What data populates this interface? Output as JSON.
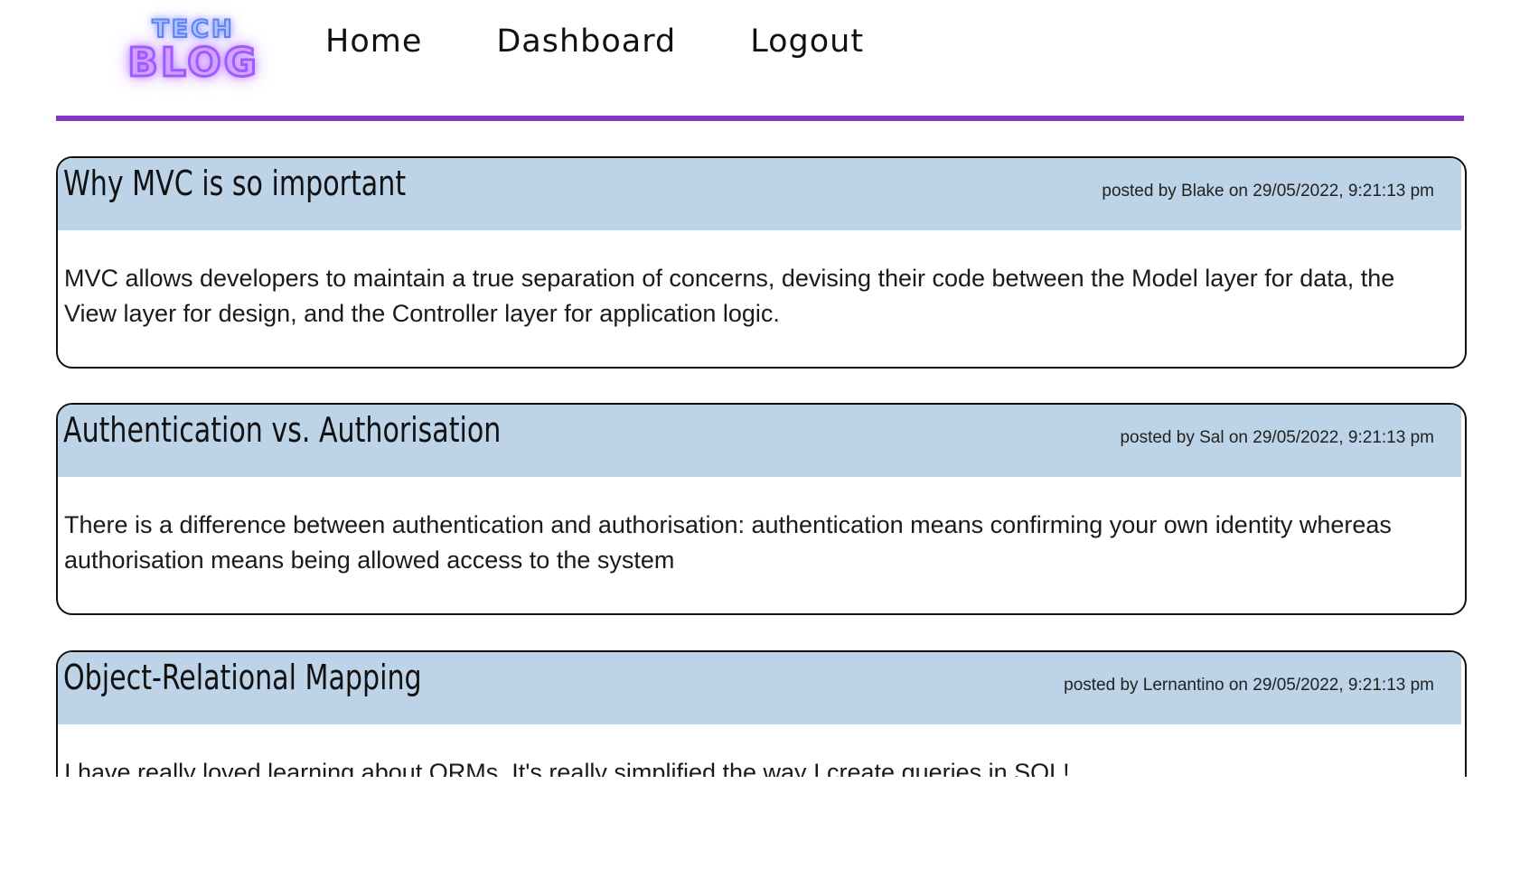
{
  "header": {
    "logo": {
      "line1": "TECH",
      "line2": "BLOG"
    },
    "nav": [
      {
        "label": "Home"
      },
      {
        "label": "Dashboard"
      },
      {
        "label": "Logout"
      }
    ]
  },
  "colors": {
    "accent": "#8338c4",
    "post_header_bg": "#bcd3e8",
    "border": "#111111"
  },
  "posts": [
    {
      "title": "Why MVC is so important",
      "meta": "posted by Blake on 29/05/2022, 9:21:13 pm",
      "body": "MVC allows developers to maintain a true separation of concerns, devising their code between the Model layer for data, the View layer for design, and the Controller layer for application logic."
    },
    {
      "title": "Authentication vs. Authorisation",
      "meta": "posted by Sal on 29/05/2022, 9:21:13 pm",
      "body": "There is a difference between authentication and authorisation: authentication means confirming your own identity whereas authorisation means being allowed access to the system"
    },
    {
      "title": "Object-Relational Mapping",
      "meta": "posted by Lernantino on 29/05/2022, 9:21:13 pm",
      "body": "I have really loved learning about ORMs. It's really simplified the way I create queries in SQL!"
    }
  ]
}
